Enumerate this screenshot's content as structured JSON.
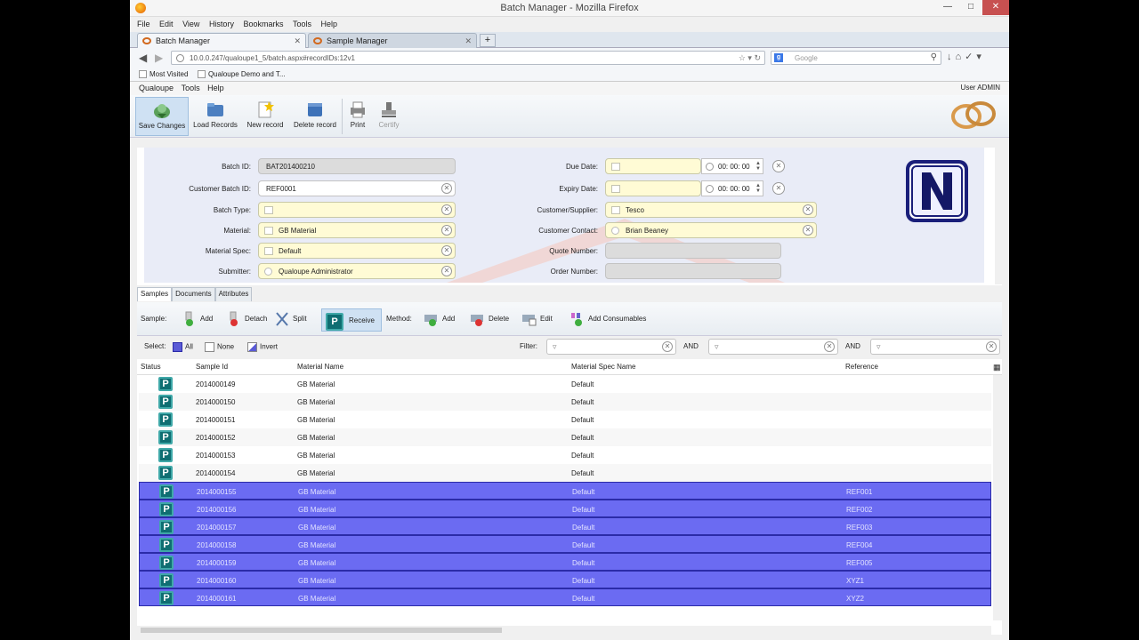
{
  "window": {
    "title": "Batch Manager - Mozilla Firefox"
  },
  "browser_menu": [
    "File",
    "Edit",
    "View",
    "History",
    "Bookmarks",
    "Tools",
    "Help"
  ],
  "tabs": [
    {
      "label": "Batch Manager"
    },
    {
      "label": "Sample Manager"
    }
  ],
  "nav": {
    "url": "10.0.0.247/qualoupe1_5/batch.aspx#recordIDs:12v1",
    "search_placeholder": "Google"
  },
  "bookmarks": [
    "Most Visited",
    "Qualoupe Demo and T..."
  ],
  "app_menu": [
    "Qualoupe",
    "Tools",
    "Help"
  ],
  "user": "User ADMIN",
  "toolbar": {
    "save": "Save Changes",
    "load": "Load Records",
    "new": "New record",
    "delete": "Delete record",
    "print": "Print",
    "certify": "Certify"
  },
  "form": {
    "batch_id": {
      "label": "Batch ID:",
      "value": "BAT201400210"
    },
    "customer_batch_id": {
      "label": "Customer Batch ID:",
      "value": "REF0001"
    },
    "batch_type": {
      "label": "Batch Type:",
      "value": ""
    },
    "material": {
      "label": "Material:",
      "value": "GB Material"
    },
    "material_spec": {
      "label": "Material Spec:",
      "value": "Default"
    },
    "submitter": {
      "label": "Submitter:",
      "value": "Qualoupe Administrator"
    },
    "due_date": {
      "label": "Due Date:",
      "time": "00: 00: 00"
    },
    "expiry_date": {
      "label": "Expiry Date:",
      "time": "00: 00: 00"
    },
    "customer_supplier": {
      "label": "Customer/Supplier:",
      "value": "Tesco"
    },
    "customer_contact": {
      "label": "Customer Contact:",
      "value": "Brian Beaney"
    },
    "quote_number": {
      "label": "Quote Number:",
      "value": ""
    },
    "order_number": {
      "label": "Order Number:",
      "value": ""
    }
  },
  "lower_tabs": [
    "Samples",
    "Documents",
    "Attributes"
  ],
  "sample_bar": {
    "sample_label": "Sample:",
    "add": "Add",
    "detach": "Detach",
    "split": "Split",
    "receive": "Receive",
    "method_label": "Method:",
    "m_add": "Add",
    "m_delete": "Delete",
    "m_edit": "Edit",
    "consumables": "Add Consumables"
  },
  "select_bar": {
    "select_label": "Select:",
    "all": "All",
    "none": "None",
    "invert": "Invert",
    "filter_label": "Filter:",
    "and1": "AND",
    "and2": "AND"
  },
  "grid": {
    "columns": [
      "Status",
      "Sample Id",
      "Material Name",
      "Material Spec Name",
      "Reference"
    ],
    "rows": [
      {
        "status": "P",
        "id": "2014000149",
        "material": "GB Material",
        "spec": "Default",
        "ref": "",
        "selected": false
      },
      {
        "status": "P",
        "id": "2014000150",
        "material": "GB Material",
        "spec": "Default",
        "ref": "",
        "selected": false
      },
      {
        "status": "P",
        "id": "2014000151",
        "material": "GB Material",
        "spec": "Default",
        "ref": "",
        "selected": false
      },
      {
        "status": "P",
        "id": "2014000152",
        "material": "GB Material",
        "spec": "Default",
        "ref": "",
        "selected": false
      },
      {
        "status": "P",
        "id": "2014000153",
        "material": "GB Material",
        "spec": "Default",
        "ref": "",
        "selected": false
      },
      {
        "status": "P",
        "id": "2014000154",
        "material": "GB Material",
        "spec": "Default",
        "ref": "",
        "selected": false
      },
      {
        "status": "P",
        "id": "2014000155",
        "material": "GB Material",
        "spec": "Default",
        "ref": "REF001",
        "selected": true
      },
      {
        "status": "P",
        "id": "2014000156",
        "material": "GB Material",
        "spec": "Default",
        "ref": "REF002",
        "selected": true
      },
      {
        "status": "P",
        "id": "2014000157",
        "material": "GB Material",
        "spec": "Default",
        "ref": "REF003",
        "selected": true
      },
      {
        "status": "P",
        "id": "2014000158",
        "material": "GB Material",
        "spec": "Default",
        "ref": "REF004",
        "selected": true
      },
      {
        "status": "P",
        "id": "2014000159",
        "material": "GB Material",
        "spec": "Default",
        "ref": "REF005",
        "selected": true
      },
      {
        "status": "P",
        "id": "2014000160",
        "material": "GB Material",
        "spec": "Default",
        "ref": "XYZ1",
        "selected": true
      },
      {
        "status": "P",
        "id": "2014000161",
        "material": "GB Material",
        "spec": "Default",
        "ref": "XYZ2",
        "selected": true
      }
    ]
  },
  "colors": {
    "selection": "#6b6bf2",
    "required_field": "#fffbd5",
    "status_icon": "#0f6e72"
  }
}
